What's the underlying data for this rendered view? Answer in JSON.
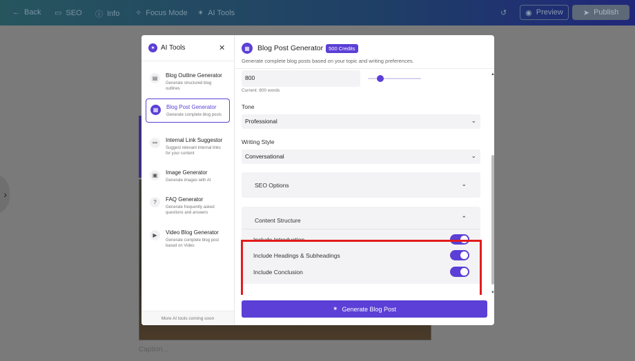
{
  "topbar": {
    "back": "Back",
    "seo": "SEO",
    "info": "Info",
    "focus_mode": "Focus Mode",
    "ai_tools": "AI Tools",
    "preview": "Preview",
    "publish": "Publish"
  },
  "caption_placeholder": "Caption...",
  "sidebar": {
    "title": "AI Tools",
    "footer": "More AI tools coming soon",
    "tools": [
      {
        "name": "Blog Outline Generator",
        "desc": "Generate structured blog outlines",
        "icon": "document-icon"
      },
      {
        "name": "Blog Post Generator",
        "desc": "Generate complete blog posts",
        "icon": "article-icon",
        "active": true
      },
      {
        "name": "Internal Link Suggestor",
        "desc": "Suggest relevant internal links for your content",
        "icon": "link-icon"
      },
      {
        "name": "Image Generator",
        "desc": "Generate images with AI",
        "icon": "image-icon"
      },
      {
        "name": "FAQ Generator",
        "desc": "Generate frequently asked questions and answers",
        "icon": "question-icon"
      },
      {
        "name": "Video Blog Generator",
        "desc": "Generate complete blog post based on Video",
        "icon": "video-icon"
      }
    ]
  },
  "main": {
    "title": "Blog Post Generator",
    "credits": "500 Credits",
    "subtitle": "Generate complete blog posts based on your topic and writing preferences.",
    "word_count": {
      "value": "800",
      "current": "Current: 800 words",
      "slider_fraction": 0.2
    },
    "tone": {
      "label": "Tone",
      "value": "Professional"
    },
    "writing_style": {
      "label": "Writing Style",
      "value": "Conversational"
    },
    "seo_options": {
      "label": "SEO Options"
    },
    "content_structure": {
      "label": "Content Structure",
      "toggles": [
        {
          "label": "Include Introduction",
          "on": true
        },
        {
          "label": "Include Headings & Subheadings",
          "on": true
        },
        {
          "label": "Include Conclusion",
          "on": true
        }
      ]
    },
    "generate_button": "Generate Blog Post"
  },
  "colors": {
    "accent": "#5b3fd6",
    "highlight": "#e21b1b"
  }
}
